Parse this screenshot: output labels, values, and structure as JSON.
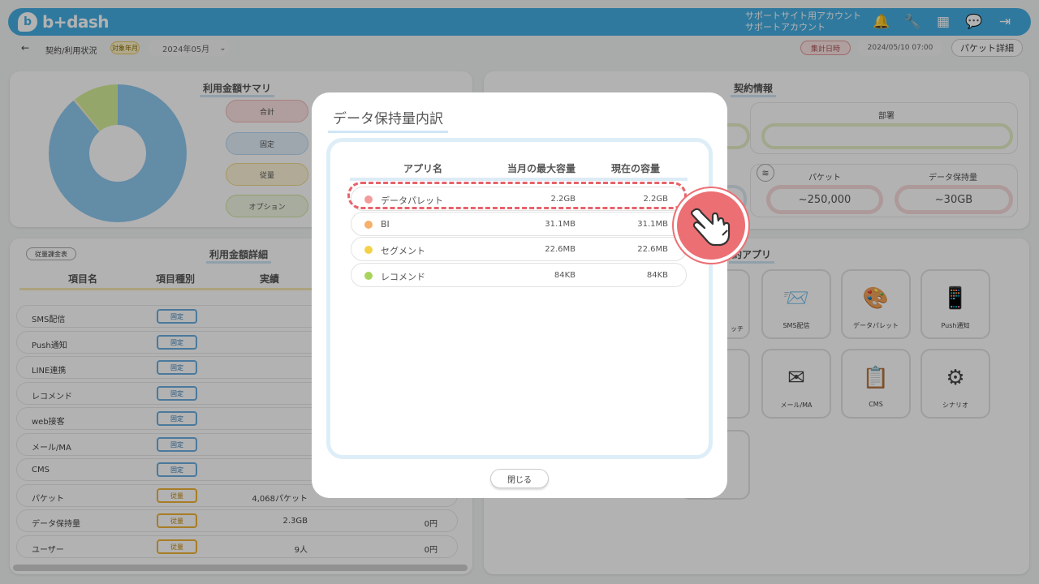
{
  "app": {
    "logo_text": "b+dash",
    "logo_glyph": "b"
  },
  "account": {
    "line1": "サポートサイト用アカウント",
    "line2": "サポートアカウント"
  },
  "header_icons": [
    "bell-icon",
    "wrench-icon",
    "grid-icon",
    "chat-icon",
    "logout-icon"
  ],
  "subbar": {
    "breadcrumb": "契約/利用状況",
    "target_month_label": "対象年月",
    "target_month_value": "2024年05月",
    "aggregated_label": "集計日時",
    "aggregated_value": "2024/05/10 07:00",
    "packet_detail_button": "パケット詳細"
  },
  "summary": {
    "title": "利用金額サマリ",
    "pills": [
      "合計",
      "固定",
      "従量",
      "オプション"
    ]
  },
  "detail": {
    "title": "利用金額詳細",
    "rate_table_button": "従量課金表",
    "columns": [
      "項目名",
      "項目種別",
      "実績"
    ],
    "rows": [
      {
        "name": "SMS配信",
        "type": "固定",
        "value": "",
        "yen": ""
      },
      {
        "name": "Push通知",
        "type": "固定",
        "value": "",
        "yen": ""
      },
      {
        "name": "LINE連携",
        "type": "固定",
        "value": "",
        "yen": ""
      },
      {
        "name": "レコメンド",
        "type": "固定",
        "value": "",
        "yen": ""
      },
      {
        "name": "web接客",
        "type": "固定",
        "value": "",
        "yen": ""
      },
      {
        "name": "メール/MA",
        "type": "固定",
        "value": "",
        "yen": ""
      },
      {
        "name": "CMS",
        "type": "固定",
        "value": "",
        "yen": ""
      },
      {
        "name": "パケット",
        "type": "従量",
        "value": "4,068パケット",
        "yen": ""
      },
      {
        "name": "データ保持量",
        "type": "従量",
        "value": "2.3GB",
        "yen": "0円"
      },
      {
        "name": "ユーザー",
        "type": "従量",
        "value": "9人",
        "yen": "0円"
      }
    ]
  },
  "contract": {
    "title": "契約情報",
    "dept_label": "部署",
    "packet_label": "パケット",
    "packet_value": "~250,000",
    "storage_label": "データ保持量",
    "storage_value": "~30GB"
  },
  "contract_apps": {
    "title": "契約アプリ",
    "title_visible": "約アプリ",
    "partial_label": "ッチ",
    "apps": [
      {
        "label": "SMS配信",
        "icon": "sms-icon"
      },
      {
        "label": "データパレット",
        "icon": "palette-icon"
      },
      {
        "label": "Push通知",
        "icon": "push-icon"
      },
      {
        "label": "メール/MA",
        "icon": "mail-icon"
      },
      {
        "label": "CMS",
        "icon": "cms-icon"
      },
      {
        "label": "シナリオ",
        "icon": "scenario-icon"
      }
    ]
  },
  "modal": {
    "title": "データ保持量内訳",
    "columns": [
      "アプリ名",
      "当月の最大容量",
      "現在の容量"
    ],
    "rows": [
      {
        "name": "データパレット",
        "max": "2.2GB",
        "current": "2.2GB",
        "color": "#f29b9b"
      },
      {
        "name": "BI",
        "max": "31.1MB",
        "current": "31.1MB",
        "color": "#f5b06a"
      },
      {
        "name": "セグメント",
        "max": "22.6MB",
        "current": "22.6MB",
        "color": "#f3d24a"
      },
      {
        "name": "レコメンド",
        "max": "84KB",
        "current": "84KB",
        "color": "#a8d45c"
      }
    ],
    "close_button": "閉じる"
  },
  "colors": {
    "brand": "#45aee2",
    "highlight": "#e8636b"
  }
}
